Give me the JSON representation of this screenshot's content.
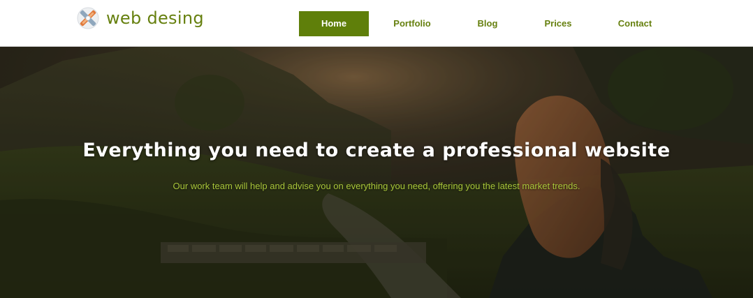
{
  "brand": {
    "name": "web desing",
    "logo_icon": "cross-tools-logo-icon",
    "color": "#66800f"
  },
  "nav": {
    "items": [
      {
        "label": "Home",
        "active": true
      },
      {
        "label": "Portfolio",
        "active": false
      },
      {
        "label": "Blog",
        "active": false
      },
      {
        "label": "Prices",
        "active": false
      },
      {
        "label": "Contact",
        "active": false
      }
    ],
    "active_bg": "#5f7f0a"
  },
  "hero": {
    "title": "Everything you need to create a professional website",
    "subtitle": "Our work team will help and advise you on everything you need, offering you the latest market trends.",
    "subtitle_color": "#a9c63a"
  }
}
